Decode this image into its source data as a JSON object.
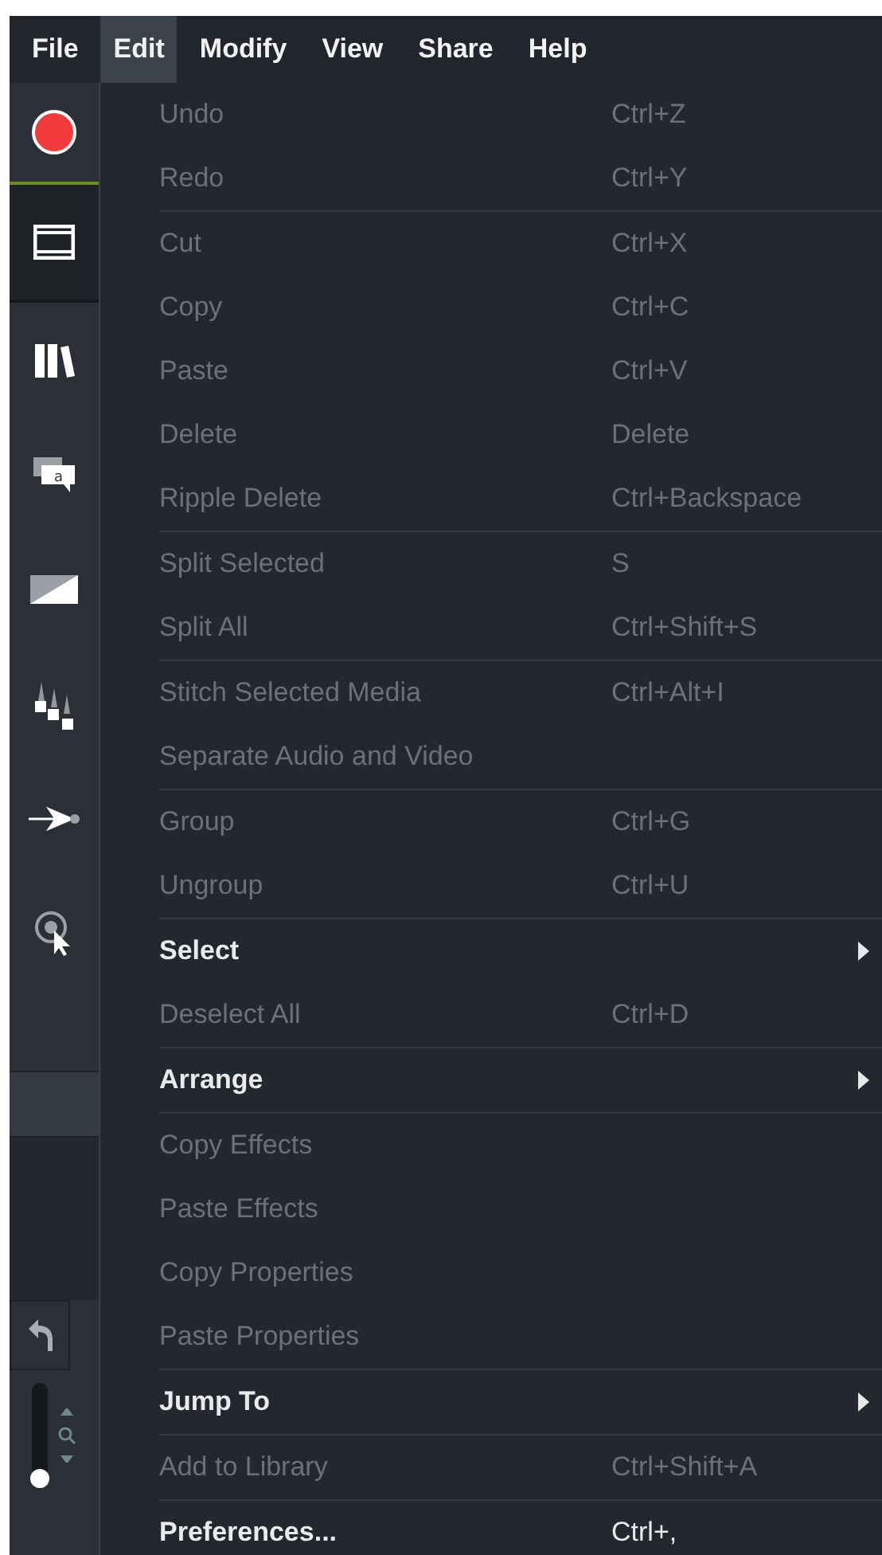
{
  "menubar": [
    {
      "label": "File",
      "selected": false
    },
    {
      "label": "Edit",
      "selected": true
    },
    {
      "label": "Modify",
      "selected": false
    },
    {
      "label": "View",
      "selected": false
    },
    {
      "label": "Share",
      "selected": false
    },
    {
      "label": "Help",
      "selected": false
    }
  ],
  "sidebar": {
    "tools": [
      {
        "kind": "record",
        "selected": false
      },
      {
        "kind": "media",
        "selected": true
      },
      {
        "kind": "library",
        "selected": false
      },
      {
        "kind": "annotations",
        "selected": false,
        "icon_text": "a"
      },
      {
        "kind": "transitions",
        "selected": false
      },
      {
        "kind": "animations",
        "selected": false
      },
      {
        "kind": "cursor-effects",
        "selected": false
      },
      {
        "kind": "click-effects",
        "selected": false
      }
    ],
    "zoom_slider": {
      "level": 0
    }
  },
  "menu": {
    "groups": [
      {
        "items": [
          {
            "label": "Undo",
            "shortcut": "Ctrl+Z",
            "disabled": true,
            "submenu": false
          },
          {
            "label": "Redo",
            "shortcut": "Ctrl+Y",
            "disabled": true,
            "submenu": false
          }
        ]
      },
      {
        "items": [
          {
            "label": "Cut",
            "shortcut": "Ctrl+X",
            "disabled": true,
            "submenu": false
          },
          {
            "label": "Copy",
            "shortcut": "Ctrl+C",
            "disabled": true,
            "submenu": false
          },
          {
            "label": "Paste",
            "shortcut": "Ctrl+V",
            "disabled": true,
            "submenu": false
          },
          {
            "label": "Delete",
            "shortcut": "Delete",
            "disabled": true,
            "submenu": false
          },
          {
            "label": "Ripple Delete",
            "shortcut": "Ctrl+Backspace",
            "disabled": true,
            "submenu": false
          }
        ]
      },
      {
        "items": [
          {
            "label": "Split Selected",
            "shortcut": "S",
            "disabled": true,
            "submenu": false
          },
          {
            "label": "Split All",
            "shortcut": "Ctrl+Shift+S",
            "disabled": true,
            "submenu": false
          }
        ]
      },
      {
        "items": [
          {
            "label": "Stitch Selected Media",
            "shortcut": "Ctrl+Alt+I",
            "disabled": true,
            "submenu": false
          },
          {
            "label": "Separate Audio and Video",
            "disabled": true,
            "submenu": false
          }
        ]
      },
      {
        "items": [
          {
            "label": "Group",
            "shortcut": "Ctrl+G",
            "disabled": true,
            "submenu": false
          },
          {
            "label": "Ungroup",
            "shortcut": "Ctrl+U",
            "disabled": true,
            "submenu": false
          }
        ]
      },
      {
        "items": [
          {
            "label": "Select",
            "disabled": false,
            "submenu": true
          },
          {
            "label": "Deselect All",
            "shortcut": "Ctrl+D",
            "disabled": true,
            "submenu": false
          }
        ]
      },
      {
        "items": [
          {
            "label": "Arrange",
            "disabled": false,
            "submenu": true
          }
        ]
      },
      {
        "items": [
          {
            "label": "Copy Effects",
            "disabled": true,
            "submenu": false
          },
          {
            "label": "Paste Effects",
            "disabled": true,
            "submenu": false
          },
          {
            "label": "Copy Properties",
            "disabled": true,
            "submenu": false
          },
          {
            "label": "Paste Properties",
            "disabled": true,
            "submenu": false
          }
        ]
      },
      {
        "items": [
          {
            "label": "Jump To",
            "disabled": false,
            "submenu": true
          }
        ]
      },
      {
        "items": [
          {
            "label": "Add to Library",
            "shortcut": "Ctrl+Shift+A",
            "disabled": true,
            "submenu": false
          }
        ]
      },
      {
        "items": [
          {
            "label": "Preferences...",
            "shortcut": "Ctrl+,",
            "disabled": false,
            "submenu": false
          }
        ]
      }
    ]
  }
}
